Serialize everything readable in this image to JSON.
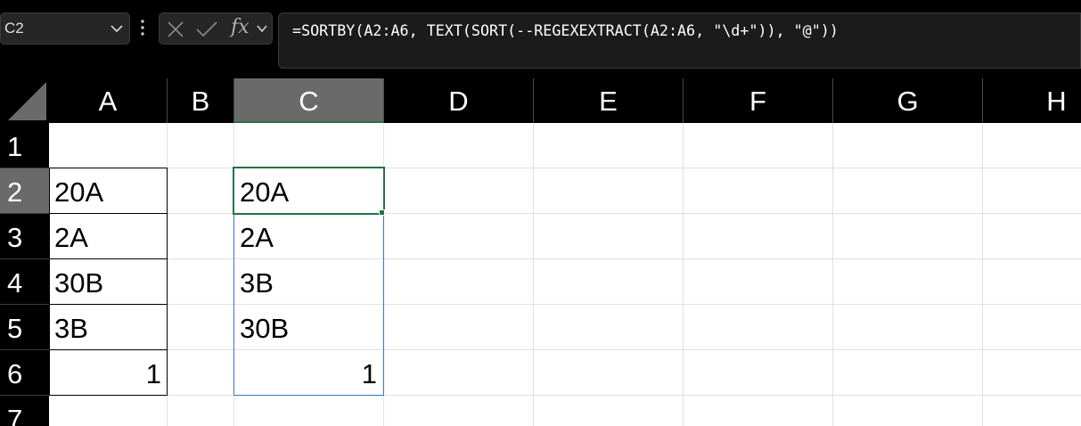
{
  "name_box": {
    "value": "C2",
    "dropdown_icon": "chevron-down-icon"
  },
  "formula_controls": {
    "more_icon": "vertical-dots-icon",
    "cancel_icon": "x-icon",
    "enter_icon": "check-icon",
    "function_label": "fx",
    "expand_icon": "chevron-down-icon"
  },
  "formula": "=SORTBY(A2:A6, TEXT(SORT(--REGEXEXTRACT(A2:A6, \"\\d+\")), \"@\"))",
  "columns": [
    "A",
    "B",
    "C",
    "D",
    "E",
    "F",
    "G",
    "H"
  ],
  "rows": [
    "1",
    "2",
    "3",
    "4",
    "5",
    "6",
    "7"
  ],
  "selected": {
    "column": "C",
    "row": "2"
  },
  "cells": {
    "A2": "20A",
    "A3": "2A",
    "A4": "30B",
    "A5": "3B",
    "A6": "1",
    "C2": "20A",
    "C3": "2A",
    "C4": "3B",
    "C5": "30B",
    "C6": "1"
  },
  "colors": {
    "selection_green": "#217346",
    "spill_border_blue": "#3a6fd8",
    "header_selected": "#6a6a6a"
  }
}
